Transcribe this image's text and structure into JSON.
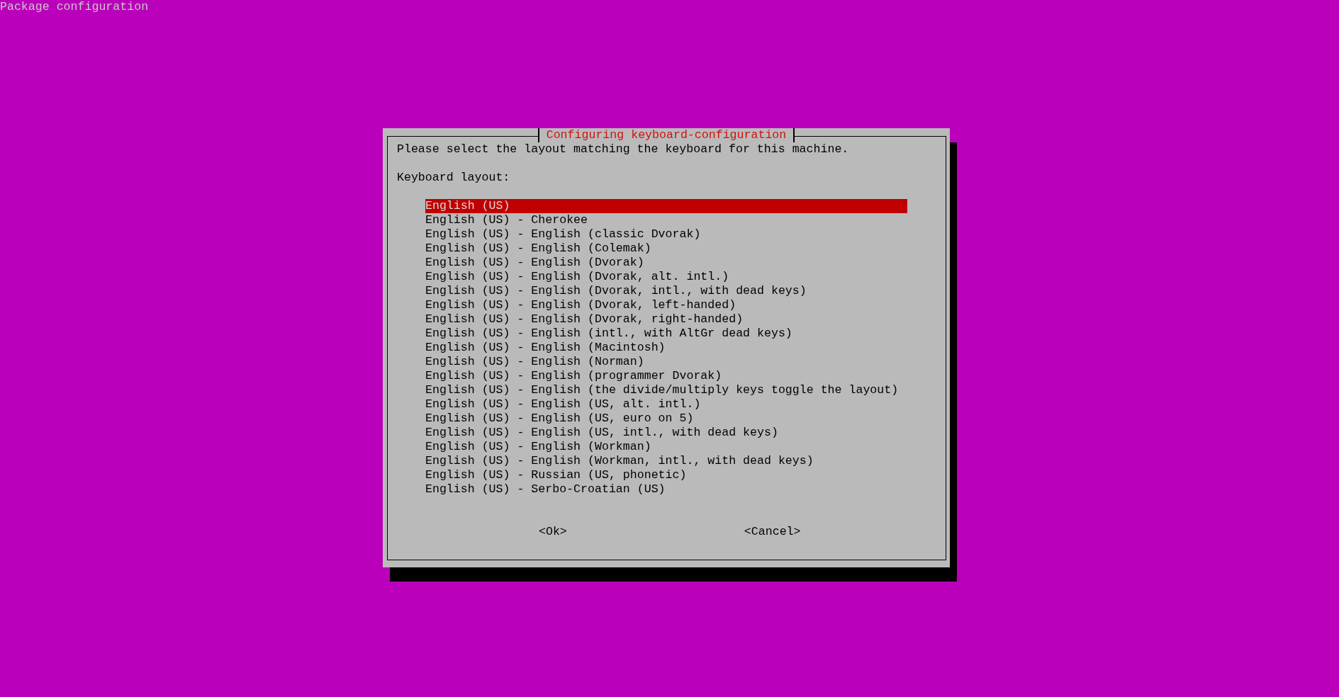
{
  "screen": {
    "title": "Package configuration"
  },
  "dialog": {
    "title": "Configuring keyboard-configuration",
    "prompt": "Please select the layout matching the keyboard for this machine.",
    "list_label": "Keyboard layout:",
    "items": [
      {
        "label": "English (US)",
        "selected": true
      },
      {
        "label": "English (US) - Cherokee",
        "selected": false
      },
      {
        "label": "English (US) - English (classic Dvorak)",
        "selected": false
      },
      {
        "label": "English (US) - English (Colemak)",
        "selected": false
      },
      {
        "label": "English (US) - English (Dvorak)",
        "selected": false
      },
      {
        "label": "English (US) - English (Dvorak, alt. intl.)",
        "selected": false
      },
      {
        "label": "English (US) - English (Dvorak, intl., with dead keys)",
        "selected": false
      },
      {
        "label": "English (US) - English (Dvorak, left-handed)",
        "selected": false
      },
      {
        "label": "English (US) - English (Dvorak, right-handed)",
        "selected": false
      },
      {
        "label": "English (US) - English (intl., with AltGr dead keys)",
        "selected": false
      },
      {
        "label": "English (US) - English (Macintosh)",
        "selected": false
      },
      {
        "label": "English (US) - English (Norman)",
        "selected": false
      },
      {
        "label": "English (US) - English (programmer Dvorak)",
        "selected": false
      },
      {
        "label": "English (US) - English (the divide/multiply keys toggle the layout)",
        "selected": false
      },
      {
        "label": "English (US) - English (US, alt. intl.)",
        "selected": false
      },
      {
        "label": "English (US) - English (US, euro on 5)",
        "selected": false
      },
      {
        "label": "English (US) - English (US, intl., with dead keys)",
        "selected": false
      },
      {
        "label": "English (US) - English (Workman)",
        "selected": false
      },
      {
        "label": "English (US) - English (Workman, intl., with dead keys)",
        "selected": false
      },
      {
        "label": "English (US) - Russian (US, phonetic)",
        "selected": false
      },
      {
        "label": "English (US) - Serbo-Croatian (US)",
        "selected": false
      }
    ],
    "buttons": [
      {
        "label": "<Ok>"
      },
      {
        "label": "<Cancel>"
      }
    ]
  }
}
